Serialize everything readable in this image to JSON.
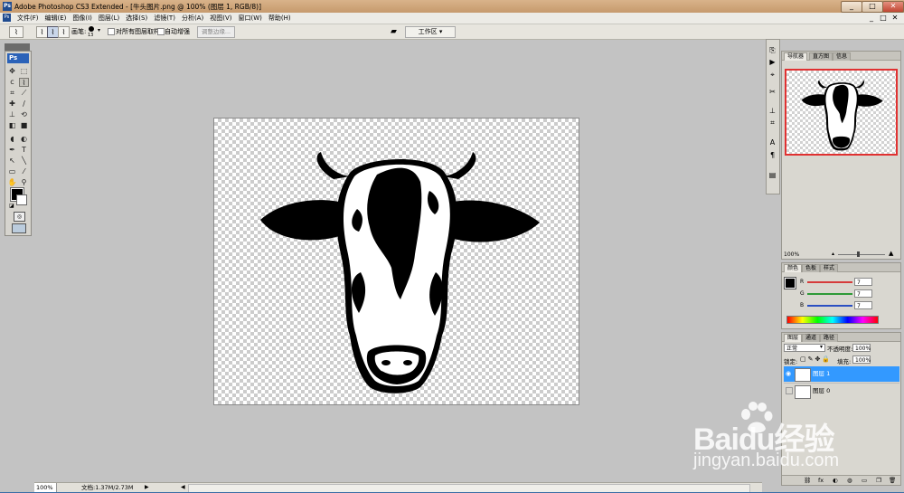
{
  "window": {
    "title": "Adobe Photoshop CS3 Extended - [牛头图片.png @ 100% (图层 1, RGB/8)]",
    "app_badge": "Ps",
    "controls": [
      "_",
      "□",
      "✕"
    ]
  },
  "menu": {
    "items": [
      "文件(F)",
      "编辑(E)",
      "图像(I)",
      "图层(L)",
      "选择(S)",
      "滤镜(T)",
      "分析(A)",
      "视图(V)",
      "窗口(W)",
      "帮助(H)"
    ],
    "doc_controls": [
      "_",
      "□",
      "✕"
    ]
  },
  "options_bar": {
    "brush_label": "画笔:",
    "brush_size": "13",
    "sample_all_layers": "对所有图层取样",
    "auto_enhance": "自动增强",
    "refine_edge": "调整边缘...",
    "workspace": "工作区 ▾"
  },
  "tools": {
    "logo": "Ps",
    "icons": [
      "move-icon",
      "marquee-icon",
      "lasso-icon",
      "quick-selection-icon",
      "crop-icon",
      "slice-icon",
      "healing-icon",
      "brush-icon",
      "stamp-icon",
      "history-brush-icon",
      "eraser-icon",
      "gradient-icon",
      "blur-icon",
      "dodge-icon",
      "pen-icon",
      "type-icon",
      "path-select-icon",
      "shape-icon",
      "notes-icon",
      "eyedropper-icon",
      "hand-icon",
      "zoom-icon"
    ],
    "glyphs": [
      "✥",
      "⬚",
      "ⅽ",
      "⌇",
      "⌗",
      "⟋",
      "✚",
      "∕",
      "⊥",
      "⟲",
      "◧",
      "■",
      "◖",
      "◐",
      "✒",
      "T",
      "↖",
      "╲",
      "▭",
      "⁄",
      "✋",
      "⚲"
    ]
  },
  "statusbar": {
    "zoom": "100%",
    "doc_info": "文档:1.37M/2.73M",
    "arrow": "▶"
  },
  "navigator": {
    "tabs": [
      "导航器",
      "直方图",
      "信息"
    ],
    "zoom": "100%"
  },
  "color_panel": {
    "tabs": [
      "颜色",
      "色板",
      "样式"
    ],
    "channels": [
      {
        "label": "R",
        "value": "7",
        "color": "#d63b3b"
      },
      {
        "label": "G",
        "value": "7",
        "color": "#2e9a38"
      },
      {
        "label": "B",
        "value": "7",
        "color": "#2b4fc2"
      }
    ]
  },
  "layers_panel": {
    "tabs": [
      "图层",
      "通道",
      "路径"
    ],
    "blend_mode": "正常",
    "opacity_label": "不透明度:",
    "opacity": "100%",
    "lock_label": "锁定:",
    "fill_label": "填充:",
    "fill": "100%",
    "layers": [
      {
        "name": "图层 1",
        "selected": true,
        "visible": true
      },
      {
        "name": "图层 0",
        "selected": false,
        "visible": false
      }
    ],
    "bottom_icons": [
      "⛓",
      "fx",
      "◐",
      "◍",
      "▭",
      "❐",
      "🗑"
    ]
  },
  "watermark": {
    "brand": "Baidu经验",
    "url": "jingyan.baidu.com"
  },
  "colors": {
    "accent": "#3399ff",
    "canvas_bg": "#c3c3c3",
    "nav_frame": "#e03131"
  }
}
